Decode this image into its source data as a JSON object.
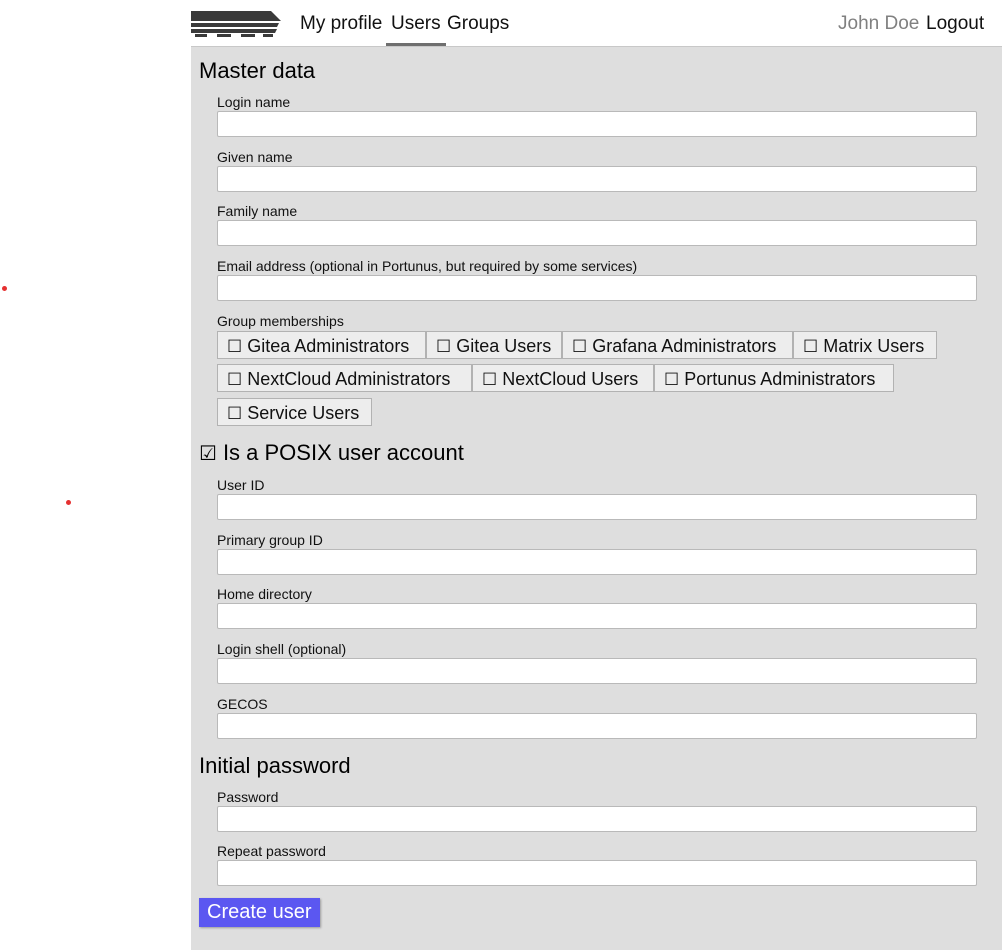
{
  "nav": {
    "links": [
      "My profile",
      "Users",
      "Groups"
    ],
    "active": "Users",
    "user_name": "John Doe",
    "logout_label": "Logout"
  },
  "master_data": {
    "heading": "Master data",
    "login_name_label": "Login name",
    "login_name_value": "",
    "given_name_label": "Given name",
    "given_name_value": "",
    "family_name_label": "Family name",
    "family_name_value": "",
    "email_label": "Email address (optional in Portunus, but required by some services)",
    "email_value": "",
    "groups_label": "Group memberships",
    "groups": [
      {
        "label": "Gitea Administrators",
        "checked": false
      },
      {
        "label": "Gitea Users",
        "checked": false
      },
      {
        "label": "Grafana Administrators",
        "checked": false
      },
      {
        "label": "Matrix Users",
        "checked": false
      },
      {
        "label": "NextCloud Administrators",
        "checked": false
      },
      {
        "label": "NextCloud Users",
        "checked": false
      },
      {
        "label": "Portunus Administrators",
        "checked": false
      },
      {
        "label": "Service Users",
        "checked": false
      }
    ]
  },
  "posix": {
    "label": "Is a POSIX user account",
    "checked": true,
    "user_id_label": "User ID",
    "primary_gid_label": "Primary group ID",
    "home_dir_label": "Home directory",
    "login_shell_label": "Login shell (optional)",
    "gecos_label": "GECOS"
  },
  "password": {
    "heading": "Initial password",
    "password_label": "Password",
    "repeat_label": "Repeat password"
  },
  "submit_label": "Create user",
  "colors": {
    "accent": "#5b57f1",
    "panel_bg": "#dedede",
    "user_name": "#808080"
  }
}
